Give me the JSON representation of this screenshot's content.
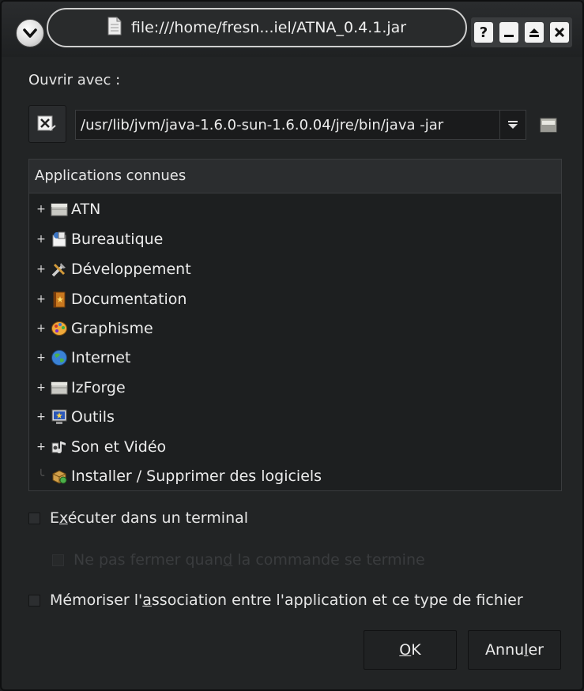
{
  "window": {
    "title": "file:///home/fresn...iel/ATNA_0.4.1.jar",
    "help_label": "?"
  },
  "open_with": {
    "label": "Ouvrir avec :",
    "command_value": "/usr/lib/jvm/java-1.6.0-sun-1.6.0.04/jre/bin/java -jar"
  },
  "tree": {
    "header": "Applications connues",
    "items": [
      {
        "label": "ATN",
        "icon": "folder-icon",
        "expandable": true
      },
      {
        "label": "Bureautique",
        "icon": "office-icon",
        "expandable": true
      },
      {
        "label": "Développement",
        "icon": "tools-icon",
        "expandable": true
      },
      {
        "label": "Documentation",
        "icon": "book-icon",
        "expandable": true
      },
      {
        "label": "Graphisme",
        "icon": "palette-icon",
        "expandable": true
      },
      {
        "label": "Internet",
        "icon": "globe-icon",
        "expandable": true
      },
      {
        "label": "IzForge",
        "icon": "folder-icon",
        "expandable": true
      },
      {
        "label": "Outils",
        "icon": "monitor-icon",
        "expandable": true
      },
      {
        "label": "Son et Vidéo",
        "icon": "multimedia-icon",
        "expandable": true
      },
      {
        "label": "Installer / Supprimer des logiciels",
        "icon": "package-icon",
        "expandable": false
      }
    ]
  },
  "options": {
    "run_terminal": {
      "pre": "E",
      "u": "x",
      "post": "écuter dans un terminal"
    },
    "keep_open": {
      "pre": "Ne pas fermer quan",
      "u": "d",
      "post": " la commande se termine"
    },
    "remember": {
      "pre": "Mémoriser l'",
      "u": "a",
      "post": "ssociation entre l'application et ce type de fichier"
    }
  },
  "buttons": {
    "ok": {
      "pre": "",
      "u": "O",
      "post": "K"
    },
    "cancel": {
      "pre": "Annu",
      "u": "l",
      "post": "er"
    }
  }
}
